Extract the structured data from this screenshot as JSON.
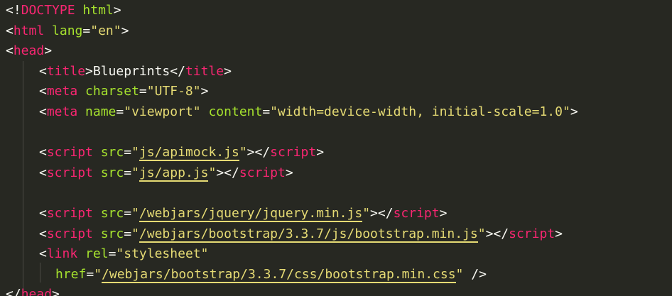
{
  "lines": [
    {
      "parts": [
        {
          "t": "<!",
          "c": "punct"
        },
        {
          "t": "DOCTYPE",
          "c": "tag"
        },
        {
          "t": " ",
          "c": "text"
        },
        {
          "t": "html",
          "c": "attr"
        },
        {
          "t": ">",
          "c": "punct"
        }
      ]
    },
    {
      "parts": [
        {
          "t": "<",
          "c": "punct"
        },
        {
          "t": "html",
          "c": "tag"
        },
        {
          "t": " ",
          "c": "text"
        },
        {
          "t": "lang",
          "c": "attr"
        },
        {
          "t": "=",
          "c": "punct"
        },
        {
          "t": "\"en\"",
          "c": "str"
        },
        {
          "t": ">",
          "c": "punct"
        }
      ]
    },
    {
      "parts": [
        {
          "t": "<",
          "c": "punct"
        },
        {
          "t": "head",
          "c": "tag"
        },
        {
          "t": ">",
          "c": "punct"
        }
      ]
    },
    {
      "parts": [
        {
          "t": "<",
          "c": "punct"
        },
        {
          "t": "title",
          "c": "tag"
        },
        {
          "t": ">",
          "c": "punct"
        },
        {
          "t": "Blueprints",
          "c": "text"
        },
        {
          "t": "</",
          "c": "punct"
        },
        {
          "t": "title",
          "c": "tag"
        },
        {
          "t": ">",
          "c": "punct"
        }
      ]
    },
    {
      "parts": [
        {
          "t": "<",
          "c": "punct"
        },
        {
          "t": "meta",
          "c": "tag"
        },
        {
          "t": " ",
          "c": "text"
        },
        {
          "t": "charset",
          "c": "attr"
        },
        {
          "t": "=",
          "c": "punct"
        },
        {
          "t": "\"UTF-8\"",
          "c": "str"
        },
        {
          "t": ">",
          "c": "punct"
        }
      ]
    },
    {
      "parts": [
        {
          "t": "<",
          "c": "punct"
        },
        {
          "t": "meta",
          "c": "tag"
        },
        {
          "t": " ",
          "c": "text"
        },
        {
          "t": "name",
          "c": "attr"
        },
        {
          "t": "=",
          "c": "punct"
        },
        {
          "t": "\"viewport\"",
          "c": "str"
        },
        {
          "t": " ",
          "c": "text"
        },
        {
          "t": "content",
          "c": "attr"
        },
        {
          "t": "=",
          "c": "punct"
        },
        {
          "t": "\"width=device-width, initial-scale=1.0\"",
          "c": "str"
        },
        {
          "t": ">",
          "c": "punct"
        }
      ]
    },
    {
      "parts": []
    },
    {
      "parts": [
        {
          "t": "<",
          "c": "punct"
        },
        {
          "t": "script",
          "c": "tag"
        },
        {
          "t": " ",
          "c": "text"
        },
        {
          "t": "src",
          "c": "attr"
        },
        {
          "t": "=",
          "c": "punct"
        },
        {
          "t": "\"",
          "c": "str"
        },
        {
          "t": "js/apimock.js",
          "c": "link-str"
        },
        {
          "t": "\"",
          "c": "str"
        },
        {
          "t": "></",
          "c": "punct"
        },
        {
          "t": "script",
          "c": "tag"
        },
        {
          "t": ">",
          "c": "punct"
        }
      ]
    },
    {
      "parts": [
        {
          "t": "<",
          "c": "punct"
        },
        {
          "t": "script",
          "c": "tag"
        },
        {
          "t": " ",
          "c": "text"
        },
        {
          "t": "src",
          "c": "attr"
        },
        {
          "t": "=",
          "c": "punct"
        },
        {
          "t": "\"",
          "c": "str"
        },
        {
          "t": "js/app.js",
          "c": "link-str"
        },
        {
          "t": "\"",
          "c": "str"
        },
        {
          "t": "></",
          "c": "punct"
        },
        {
          "t": "script",
          "c": "tag"
        },
        {
          "t": ">",
          "c": "punct"
        }
      ]
    },
    {
      "parts": []
    },
    {
      "parts": [
        {
          "t": "<",
          "c": "punct"
        },
        {
          "t": "script",
          "c": "tag"
        },
        {
          "t": " ",
          "c": "text"
        },
        {
          "t": "src",
          "c": "attr"
        },
        {
          "t": "=",
          "c": "punct"
        },
        {
          "t": "\"",
          "c": "str"
        },
        {
          "t": "/webjars/jquery/jquery.min.js",
          "c": "link-str"
        },
        {
          "t": "\"",
          "c": "str"
        },
        {
          "t": "></",
          "c": "punct"
        },
        {
          "t": "script",
          "c": "tag"
        },
        {
          "t": ">",
          "c": "punct"
        }
      ]
    },
    {
      "parts": [
        {
          "t": "<",
          "c": "punct"
        },
        {
          "t": "script",
          "c": "tag"
        },
        {
          "t": " ",
          "c": "text"
        },
        {
          "t": "src",
          "c": "attr"
        },
        {
          "t": "=",
          "c": "punct"
        },
        {
          "t": "\"",
          "c": "str"
        },
        {
          "t": "/webjars/bootstrap/3.3.7/js/bootstrap.min.js",
          "c": "link-str"
        },
        {
          "t": "\"",
          "c": "str"
        },
        {
          "t": "></",
          "c": "punct"
        },
        {
          "t": "script",
          "c": "tag"
        },
        {
          "t": ">",
          "c": "punct"
        }
      ]
    },
    {
      "parts": [
        {
          "t": "<",
          "c": "punct"
        },
        {
          "t": "link",
          "c": "tag"
        },
        {
          "t": " ",
          "c": "text"
        },
        {
          "t": "rel",
          "c": "attr"
        },
        {
          "t": "=",
          "c": "punct"
        },
        {
          "t": "\"stylesheet\"",
          "c": "str"
        }
      ]
    },
    {
      "parts": [
        {
          "t": "href",
          "c": "attr"
        },
        {
          "t": "=",
          "c": "punct"
        },
        {
          "t": "\"",
          "c": "str"
        },
        {
          "t": "/webjars/bootstrap/3.3.7/css/bootstrap.min.css",
          "c": "link-str"
        },
        {
          "t": "\"",
          "c": "str"
        },
        {
          "t": " />",
          "c": "punct"
        }
      ]
    },
    {
      "parts": [
        {
          "t": "</",
          "c": "punct"
        },
        {
          "t": "head",
          "c": "tag"
        },
        {
          "t": ">",
          "c": "punct"
        }
      ]
    }
  ],
  "colors": {
    "background": "#272822",
    "tag": "#f92672",
    "attr": "#a6e22e",
    "string": "#e6db74",
    "text": "#f8f8f2",
    "indent_guide": "#4a4a44"
  }
}
